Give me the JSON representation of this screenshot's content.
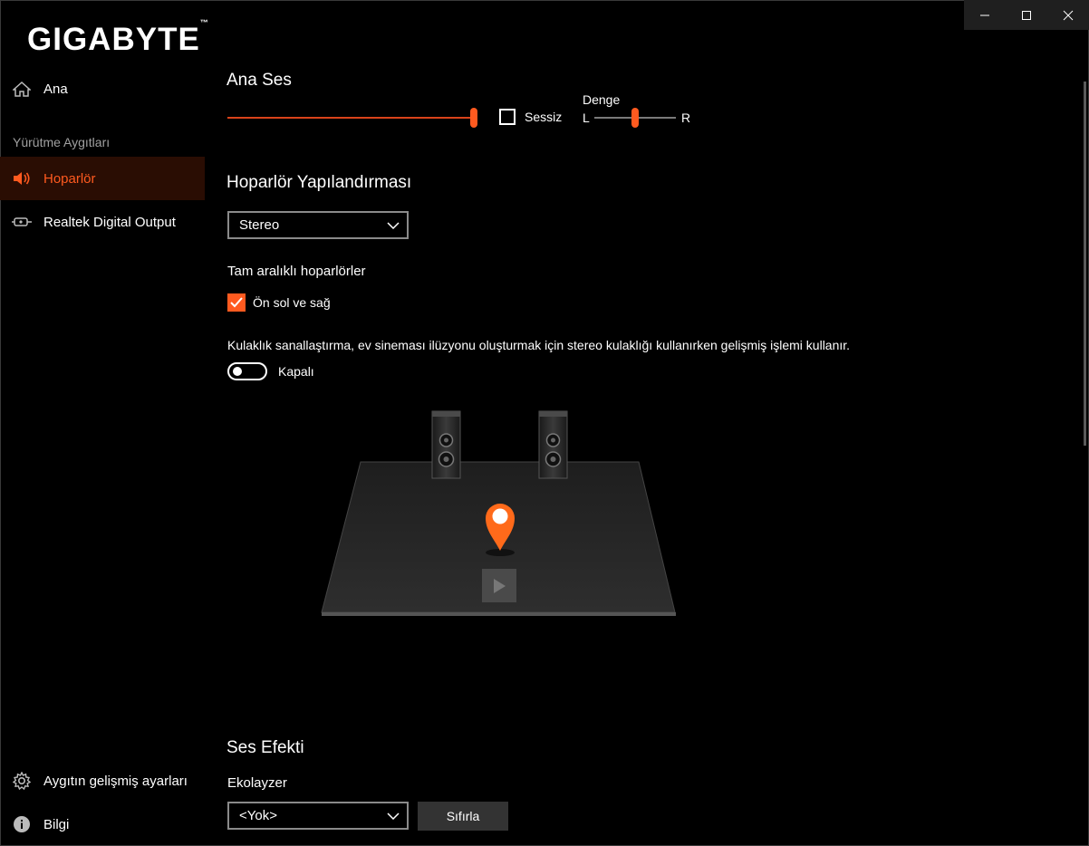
{
  "brand": {
    "logo_text": "GIGABYTE",
    "trademark": "™"
  },
  "sidebar": {
    "home_label": "Ana",
    "section_label": "Yürütme Aygıtları",
    "devices": [
      {
        "label": "Hoparlör",
        "icon": "speaker-icon",
        "active": true
      },
      {
        "label": "Realtek Digital Output",
        "icon": "digital-output-icon",
        "active": false
      }
    ],
    "advanced_label": "Aygıtın gelişmiş ayarları",
    "info_label": "Bilgi"
  },
  "main_volume": {
    "title": "Ana Ses",
    "volume_level": 1.0,
    "mute_label": "Sessiz",
    "mute_checked": false,
    "balance_label": "Denge",
    "balance_left": "L",
    "balance_right": "R",
    "balance_level": 0.5
  },
  "speaker_config": {
    "title": "Hoparlör Yapılandırması",
    "selected": "Stereo",
    "full_range_title": "Tam aralıklı hoparlörler",
    "front_lr_label": "Ön sol ve sağ",
    "front_lr_checked": true,
    "virtualization_desc": "Kulaklık sanallaştırma, ev sineması ilüzyonu oluşturmak için stereo kulaklığı kullanırken gelişmiş işlemi kullanır.",
    "toggle_label": "Kapalı",
    "toggle_on": false
  },
  "sound_effects": {
    "title": "Ses Efekti",
    "equalizer_label": "Ekolayzer",
    "equalizer_selected": "<Yok>",
    "reset_label": "Sıfırla"
  },
  "colors": {
    "accent": "#ff5a1f",
    "active_bg": "#2a0d03",
    "background": "#000000"
  }
}
